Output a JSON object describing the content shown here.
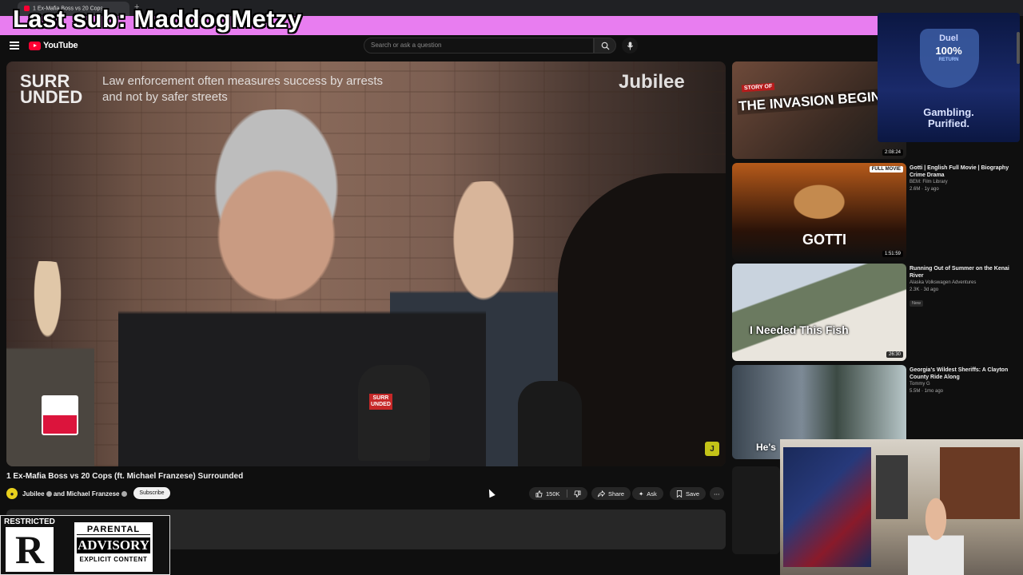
{
  "overlay": {
    "last_sub": "Last sub: MaddogMetzy"
  },
  "browser": {
    "tab_title": "1 Ex-Mafia Boss vs 20 Cops"
  },
  "header": {
    "logo_text": "YouTube",
    "search_placeholder": "Search or ask a question"
  },
  "player": {
    "brand_left_top": "SURR",
    "brand_left_bottom": "UNDED",
    "caption": "Law enforcement often measures success by arrests and not by safer streets",
    "brand_right": "Jubilee",
    "mic_label_top": "SURR",
    "mic_label_bottom": "UNDED",
    "badge": "J"
  },
  "video": {
    "title": "1 Ex-Mafia Boss vs 20 Cops (ft. Michael Franzese) Surrounded",
    "channel": "Jubilee",
    "channel_joined": "and Michael Franzese",
    "subscribe_label": "Subscribe",
    "likes": "150K",
    "share_label": "Share",
    "ask_label": "Ask",
    "save_label": "Save"
  },
  "sidebar": {
    "items": [
      {
        "thumb_text": "THE INVASION BEGINS",
        "stub": "STORY OF",
        "duration": "2:08:24",
        "title": "",
        "channel": "",
        "views": ""
      },
      {
        "thumb_text": "GOTTI",
        "badge": "FULL MOVIE",
        "duration": "1:51:59",
        "title": "Gotti | English Full Movie | Biography Crime Drama",
        "channel": "BEM: Film Library",
        "views": "2.6M · 1y ago"
      },
      {
        "thumb_text": "I Needed This Fish",
        "duration": "26:30",
        "title": "Running Out of Summer on the Kenai River",
        "channel": "Alaska Volkswagen Adventures",
        "views": "2.3K · 3d ago",
        "new": "New"
      },
      {
        "thumb_text": "He's",
        "title": "Georgia's Wildest Sheriffs: A Clayton County Ride Along",
        "channel": "Tommy G",
        "views": "5.5M · 1mo ago"
      }
    ]
  },
  "ad": {
    "brand": "Duel",
    "percent": "100%",
    "return": "RETURN",
    "slogan_1": "Gambling.",
    "slogan_2": "Purified."
  },
  "restricted": {
    "label": "RESTRICTED",
    "letter": "R",
    "pa_1": "PARENTAL",
    "pa_2": "ADVISORY",
    "pa_3": "EXPLICIT CONTENT"
  }
}
